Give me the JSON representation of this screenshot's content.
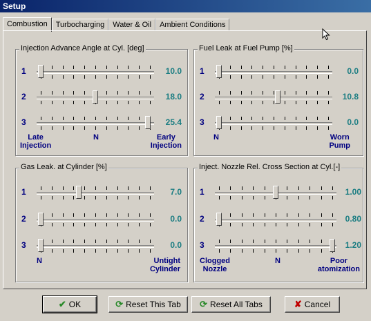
{
  "window": {
    "title": "Setup"
  },
  "tabs": [
    {
      "label": "Combustion",
      "active": true
    },
    {
      "label": "Turbocharging",
      "active": false
    },
    {
      "label": "Water & Oil",
      "active": false
    },
    {
      "label": "Ambient Conditions",
      "active": false
    }
  ],
  "groups": {
    "injection_advance": {
      "title": "Injection Advance Angle  at Cyl. [deg]",
      "rows": [
        {
          "num": "1",
          "value": "10.0",
          "pos": 0.0
        },
        {
          "num": "2",
          "value": "18.0",
          "pos": 0.5
        },
        {
          "num": "3",
          "value": "25.4",
          "pos": 0.98
        }
      ],
      "labels": {
        "left": "Late\nInjection",
        "mid": "N",
        "right": "Early\nInjection"
      }
    },
    "fuel_leak": {
      "title": "Fuel Leak at Fuel Pump [%]",
      "rows": [
        {
          "num": "1",
          "value": "0.0",
          "pos": 0.0
        },
        {
          "num": "2",
          "value": "10.8",
          "pos": 0.54
        },
        {
          "num": "3",
          "value": "0.0",
          "pos": 0.0
        }
      ],
      "labels": {
        "left": "N",
        "right": "Worn\nPump"
      }
    },
    "gas_leak": {
      "title": "Gas Leak. at Cylinder [%]",
      "rows": [
        {
          "num": "1",
          "value": "7.0",
          "pos": 0.35
        },
        {
          "num": "2",
          "value": "0.0",
          "pos": 0.0
        },
        {
          "num": "3",
          "value": "0.0",
          "pos": 0.0
        }
      ],
      "labels": {
        "left": "N",
        "right": "Untight\nCylinder"
      }
    },
    "nozzle": {
      "title": "Inject. Nozzle Rel. Cross Section at Cyl.[-]",
      "rows": [
        {
          "num": "1",
          "value": "1.00",
          "pos": 0.5
        },
        {
          "num": "2",
          "value": "0.80",
          "pos": 0.0
        },
        {
          "num": "3",
          "value": "1.20",
          "pos": 1.0
        }
      ],
      "labels": {
        "left": "Clogged\nNozzle",
        "mid": "N",
        "right": "Poor\natomization"
      }
    }
  },
  "buttons": {
    "ok": "OK",
    "reset_tab": "Reset This Tab",
    "reset_all": "Reset All Tabs",
    "cancel": "Cancel"
  },
  "colors": {
    "value": "#1b7d82",
    "label": "#000080",
    "ok_icon": "#2a8a2a",
    "reset_icon": "#2a8a2a",
    "cancel_icon": "#c00000"
  }
}
